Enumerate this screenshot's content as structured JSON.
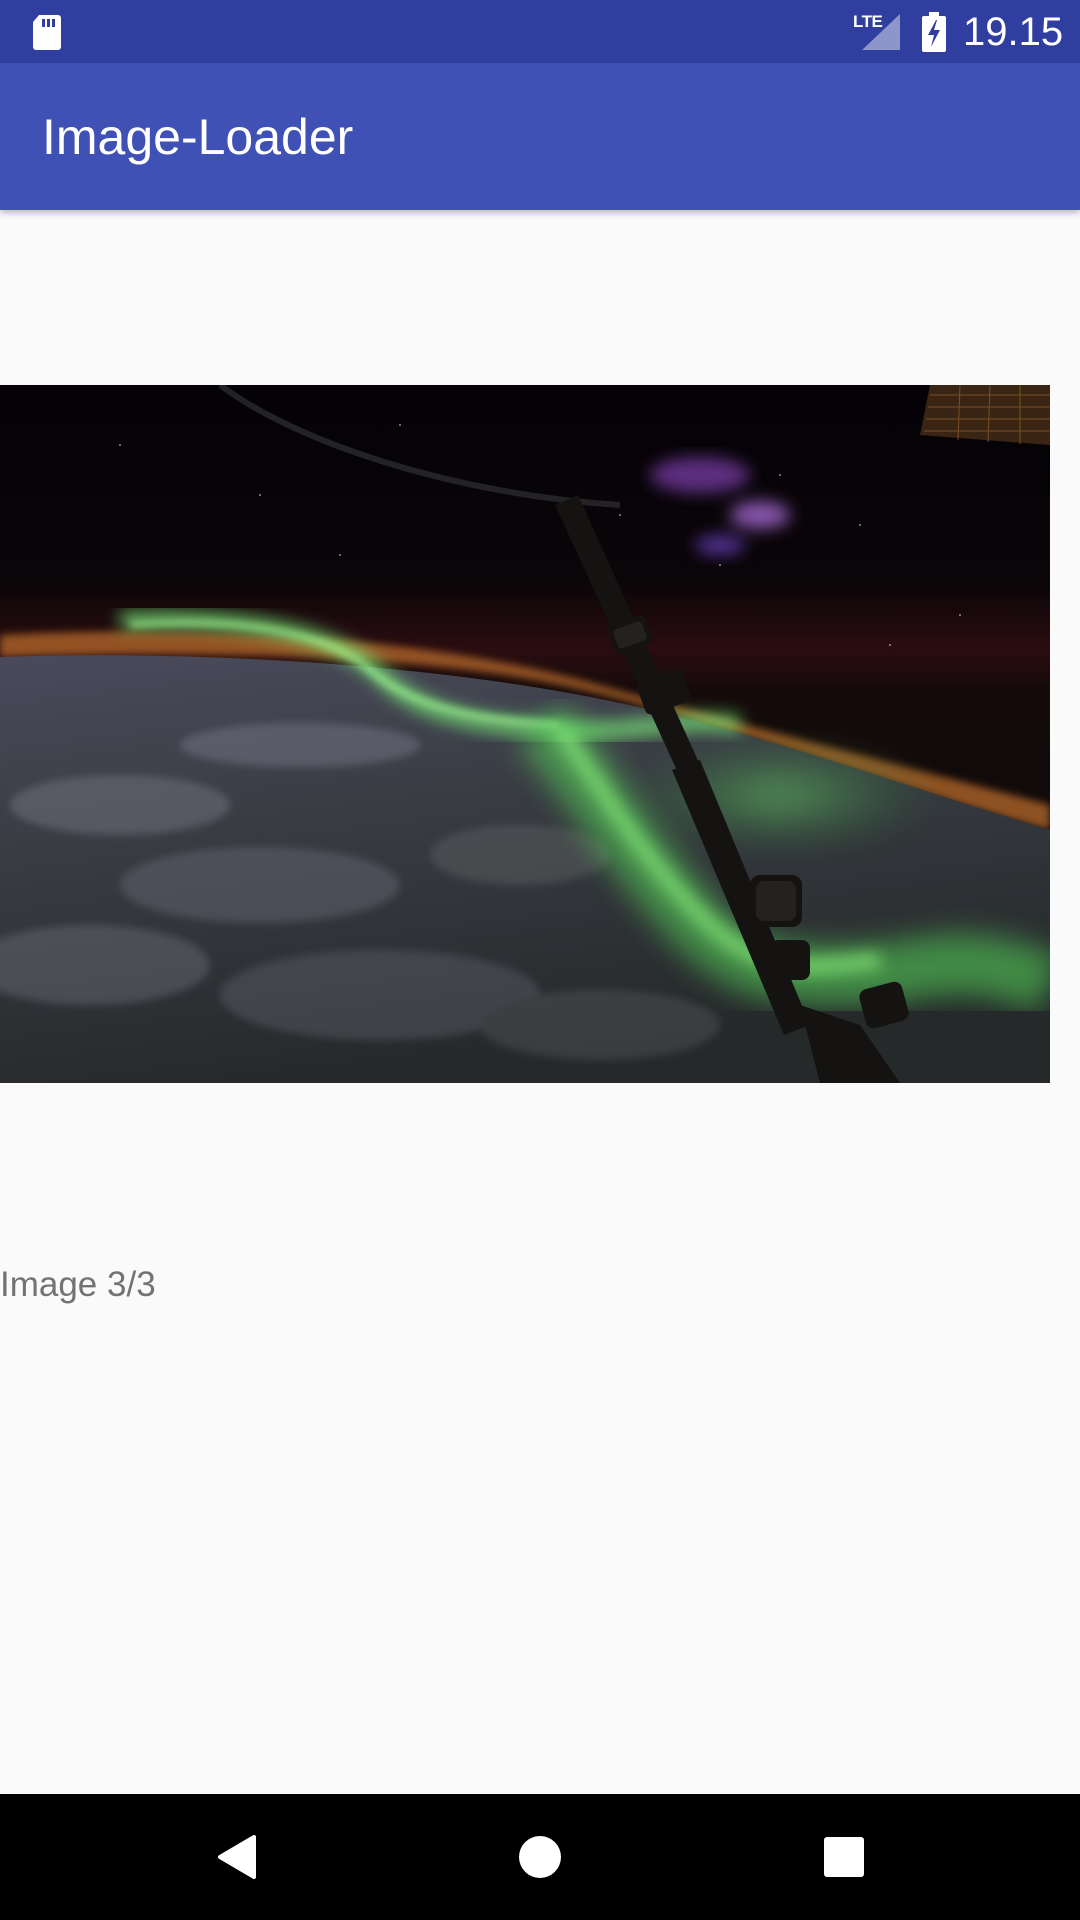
{
  "status_bar": {
    "time": "19.15",
    "network": "LTE",
    "icons": [
      "sd-card-icon",
      "lte-signal-icon",
      "battery-charging-icon"
    ]
  },
  "app_bar": {
    "title": "Image-Loader"
  },
  "viewer": {
    "image_description": "aurora-over-earth-photo",
    "counter": "Image 3/3"
  },
  "nav_bar": {
    "icons": [
      "back-icon",
      "home-icon",
      "recents-icon"
    ]
  },
  "colors": {
    "status_bar": "#303f9f",
    "app_bar": "#3f51b5",
    "background": "#fafafa",
    "counter_text": "#737373",
    "nav_bar": "#000000"
  }
}
